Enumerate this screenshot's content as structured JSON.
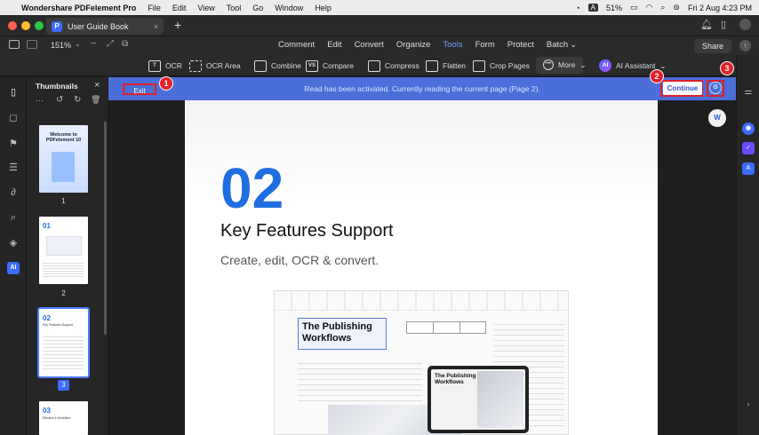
{
  "menubar": {
    "apple": "",
    "app_name": "Wondershare PDFelement Pro",
    "items": [
      "File",
      "Edit",
      "View",
      "Tool",
      "Go",
      "Window",
      "Help"
    ],
    "status_a": "A",
    "battery": "51%",
    "datetime": "Fri 2 Aug  4:23 PM"
  },
  "tab": {
    "title": "User Guide Book",
    "add": "+"
  },
  "toolbar": {
    "zoom": "151%",
    "nav": [
      {
        "label": "Comment",
        "active": false
      },
      {
        "label": "Edit",
        "active": false
      },
      {
        "label": "Convert",
        "active": false
      },
      {
        "label": "Organize",
        "active": false
      },
      {
        "label": "Tools",
        "active": true
      },
      {
        "label": "Form",
        "active": false
      },
      {
        "label": "Protect",
        "active": false
      },
      {
        "label": "Batch",
        "active": false
      }
    ],
    "share": "Share"
  },
  "tools": {
    "ocr": "OCR",
    "ocr_area": "OCR Area",
    "combine": "Combine",
    "compare": "Compare",
    "compress": "Compress",
    "flatten": "Flatten",
    "crop_pages": "Crop Pages",
    "more": "More",
    "ai_badge": "AI",
    "ai_assistant": "AI Assistant"
  },
  "thumbnails": {
    "title": "Thumbnails",
    "pages": [
      "1",
      "2",
      "3"
    ],
    "thumb1_title": "Welcome to PDFelement 10",
    "thumb2_num": "01",
    "thumb3_num": "02",
    "thumb3_title": "Key Features Support",
    "thumb4_num": "03",
    "thumb4_title": "Efficient & Workflow"
  },
  "read": {
    "exit": "Exit",
    "message": "Read has been activated. Currently reading the current page (Page 2).",
    "continue": "Continue",
    "badges": [
      "1",
      "2",
      "3"
    ]
  },
  "page": {
    "number": "02",
    "title": "Key Features Support",
    "subtitle": "Create, edit, OCR & convert.",
    "shot_heading": "The Publishing Workflows",
    "shot_heading_small": "The Publishing Workflows"
  },
  "colors": {
    "accent": "#4b6ed9",
    "brand_number": "#1f6de0",
    "annotation": "#e0202a"
  }
}
